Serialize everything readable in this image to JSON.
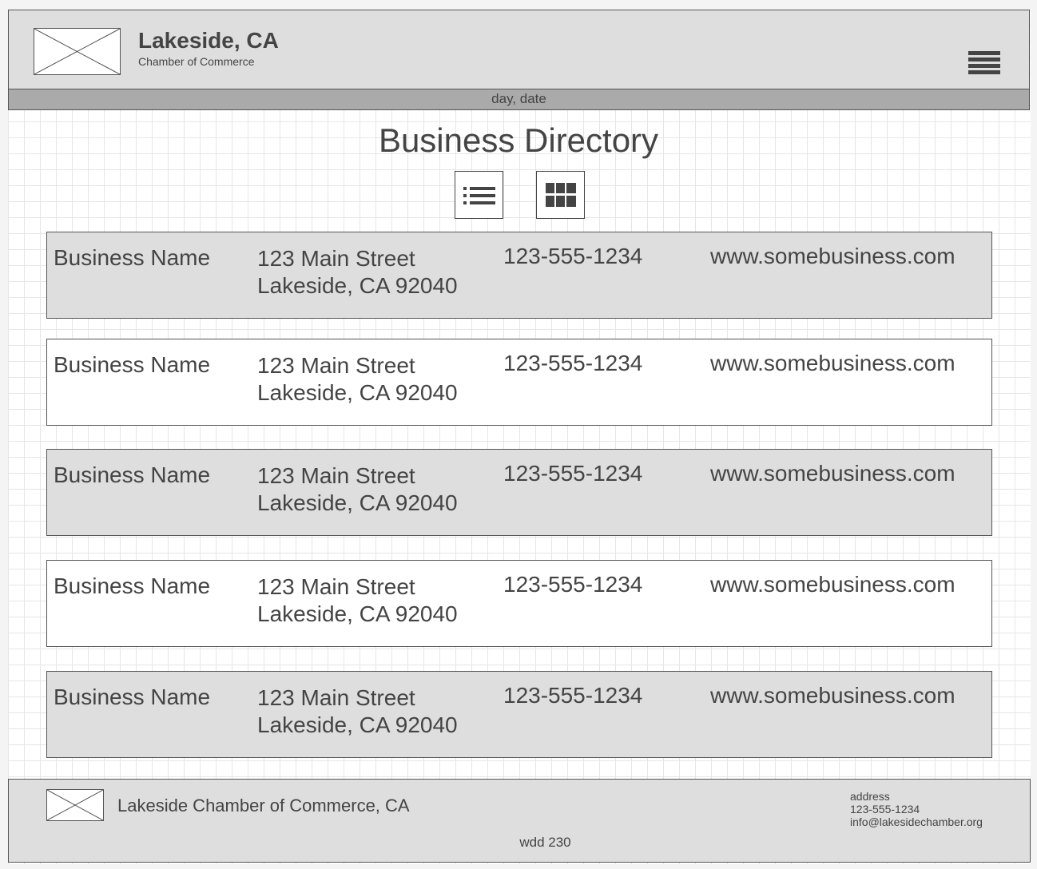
{
  "header": {
    "title": "Lakeside, CA",
    "subtitle": "Chamber of Commerce",
    "logo_icon": "image-placeholder-icon",
    "menu_icon": "hamburger-menu-icon"
  },
  "date_bar": {
    "text": "day, date"
  },
  "main": {
    "title": "Business Directory",
    "view_toggles": [
      {
        "name": "list-view",
        "icon": "list-view-icon"
      },
      {
        "name": "grid-view",
        "icon": "grid-view-icon"
      }
    ],
    "rows": [
      {
        "name": "Business Name",
        "address_line1": "123 Main Street",
        "address_line2": "Lakeside, CA 92040",
        "phone": "123-555-1234",
        "website": "www.somebusiness.com",
        "shaded": true
      },
      {
        "name": "Business Name",
        "address_line1": "123 Main Street",
        "address_line2": "Lakeside, CA 92040",
        "phone": "123-555-1234",
        "website": "www.somebusiness.com",
        "shaded": false
      },
      {
        "name": "Business Name",
        "address_line1": "123 Main Street",
        "address_line2": "Lakeside, CA 92040",
        "phone": "123-555-1234",
        "website": "www.somebusiness.com",
        "shaded": true
      },
      {
        "name": "Business Name",
        "address_line1": "123 Main Street",
        "address_line2": "Lakeside, CA 92040",
        "phone": "123-555-1234",
        "website": "www.somebusiness.com",
        "shaded": false
      },
      {
        "name": "Business Name",
        "address_line1": "123 Main Street",
        "address_line2": "Lakeside, CA 92040",
        "phone": "123-555-1234",
        "website": "www.somebusiness.com",
        "shaded": true
      }
    ]
  },
  "footer": {
    "org_name": "Lakeside Chamber of Commerce, CA",
    "contact": {
      "address": "address",
      "phone": "123-555-1234",
      "email": "info@lakesidechamber.org"
    },
    "course": "wdd 230"
  },
  "colors": {
    "header_bg": "#dedede",
    "date_bar_bg": "#aaaaaa",
    "text": "#444444",
    "row_shaded": "#dedede",
    "row_plain": "#ffffff"
  }
}
